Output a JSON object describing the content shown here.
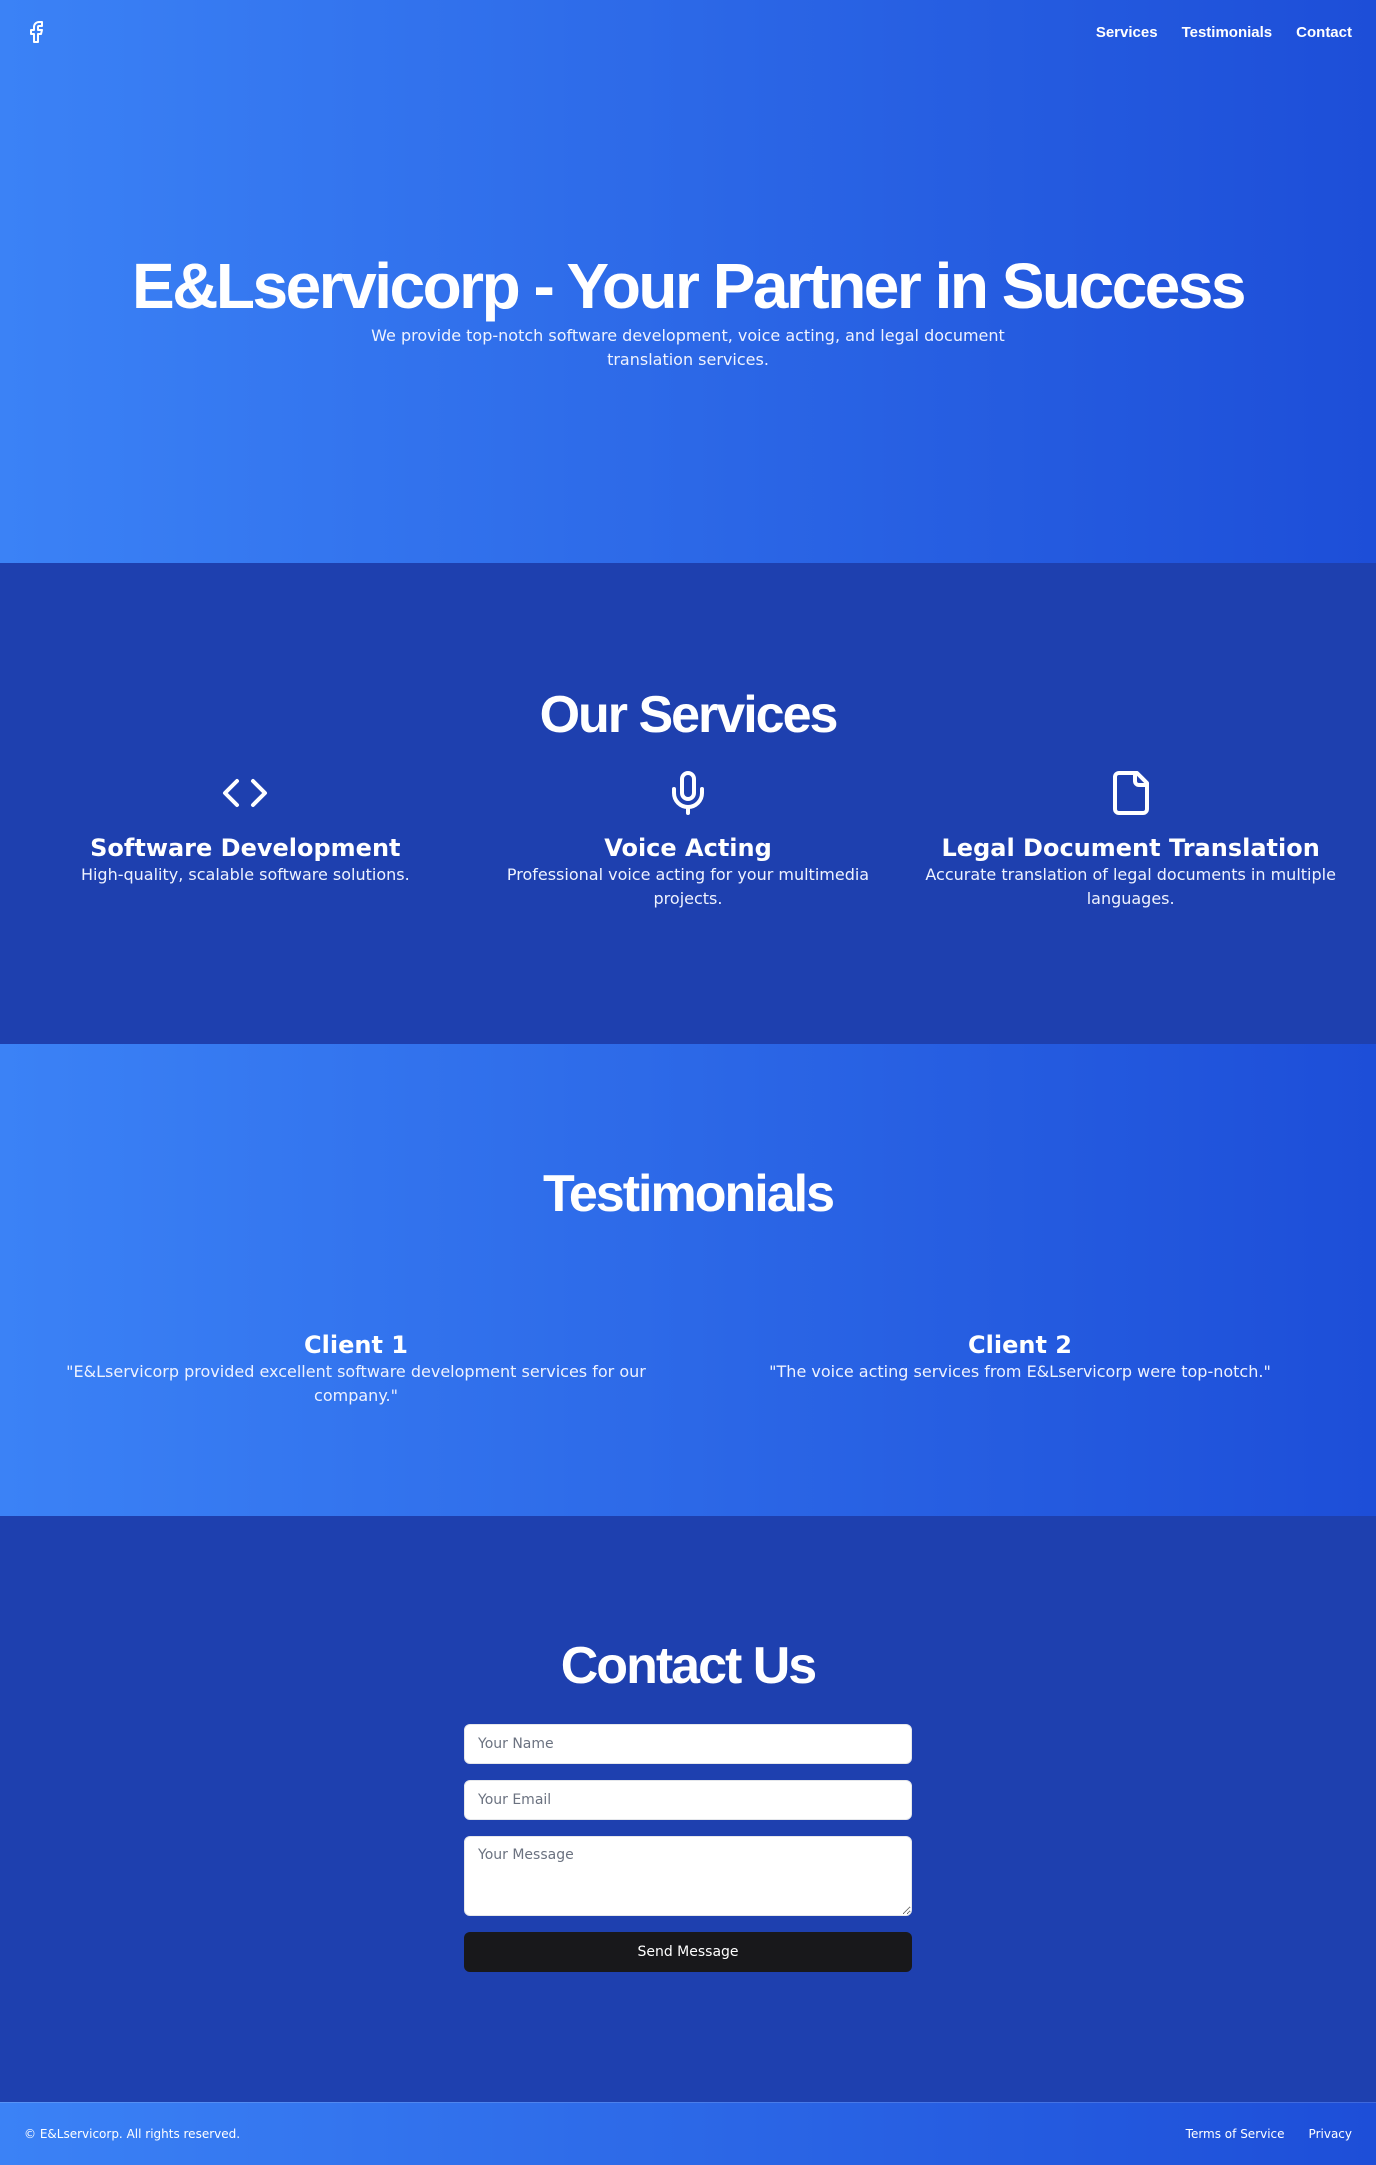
{
  "header": {
    "logo_icon": "facebook-icon",
    "nav": [
      {
        "label": "Services"
      },
      {
        "label": "Testimonials"
      },
      {
        "label": "Contact"
      }
    ]
  },
  "hero": {
    "title": "E&Lservicorp - Your Partner in Success",
    "subtitle": "We provide top-notch software development, voice acting, and legal document translation services."
  },
  "services": {
    "title": "Our Services",
    "items": [
      {
        "icon": "code-icon",
        "title": "Software Development",
        "description": "High-quality, scalable software solutions."
      },
      {
        "icon": "microphone-icon",
        "title": "Voice Acting",
        "description": "Professional voice acting for your multimedia projects."
      },
      {
        "icon": "document-icon",
        "title": "Legal Document Translation",
        "description": "Accurate translation of legal documents in multiple languages."
      }
    ]
  },
  "testimonials": {
    "title": "Testimonials",
    "items": [
      {
        "name": "Client 1",
        "quote": "\"E&Lservicorp provided excellent software development services for our company.\""
      },
      {
        "name": "Client 2",
        "quote": "\"The voice acting services from E&Lservicorp were top-notch.\""
      }
    ]
  },
  "contact": {
    "title": "Contact Us",
    "name_placeholder": "Your Name",
    "email_placeholder": "Your Email",
    "message_placeholder": "Your Message",
    "send_label": "Send Message"
  },
  "footer": {
    "copyright": "© E&Lservicorp. All rights reserved.",
    "links": [
      {
        "label": "Terms of Service"
      },
      {
        "label": "Privacy"
      }
    ]
  },
  "colors": {
    "gradient_start": "#3b82f6",
    "gradient_end": "#1d4ed8",
    "dark_section": "#1e40af",
    "button": "#18181b"
  }
}
